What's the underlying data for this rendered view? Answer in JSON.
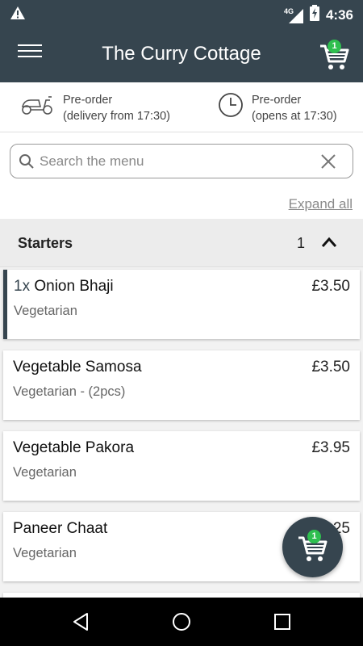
{
  "status_bar": {
    "network": "4G",
    "time": "4:36"
  },
  "app_bar": {
    "title": "The Curry Cottage",
    "cart_count": "1"
  },
  "info": {
    "delivery": {
      "line1": "Pre-order",
      "line2": "(delivery from 17:30)"
    },
    "opening": {
      "line1": "Pre-order",
      "line2": "(opens at 17:30)"
    }
  },
  "search": {
    "placeholder": "Search the menu",
    "value": ""
  },
  "expand_all_label": "Expand all",
  "section": {
    "title": "Starters",
    "count": "1"
  },
  "items": [
    {
      "qty": "1x",
      "name": "Onion Bhaji",
      "price": "£3.50",
      "desc": "Vegetarian"
    },
    {
      "name": "Vegetable Samosa",
      "price": "£3.50",
      "desc": "Vegetarian - (2pcs)"
    },
    {
      "name": "Vegetable Pakora",
      "price": "£3.95",
      "desc": "Vegetarian"
    },
    {
      "name": "Paneer Chaat",
      "price": "£4.25",
      "desc": "Vegetarian"
    }
  ],
  "fab_cart_count": "1",
  "colors": {
    "primary": "#36454f",
    "badge": "#2fbf4f"
  }
}
